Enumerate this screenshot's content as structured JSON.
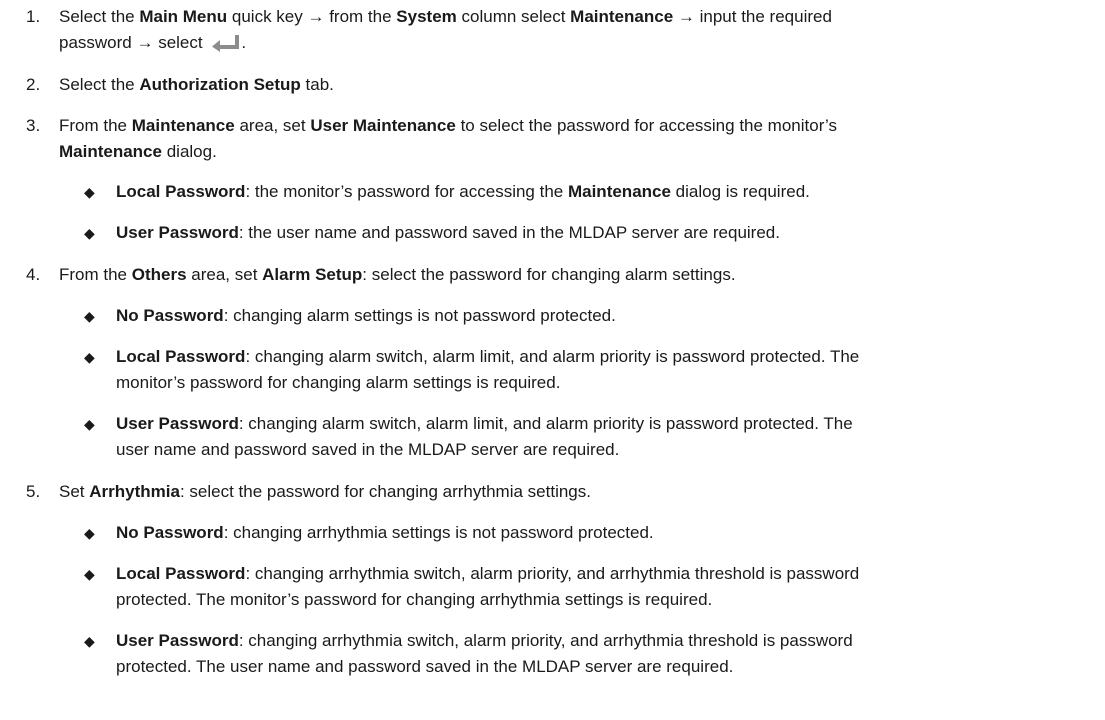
{
  "steps": [
    {
      "num": "1.",
      "seg": [
        "Select the ",
        "Main Menu",
        " quick key → from the ",
        "System",
        " column select ",
        "Maintenance",
        " → input the required",
        "password → select ",
        "."
      ]
    },
    {
      "num": "2.",
      "seg": [
        "Select the ",
        "Authorization Setup",
        " tab."
      ]
    },
    {
      "num": "3.",
      "seg": [
        "From the ",
        "Maintenance",
        " area, set ",
        "User Maintenance",
        " to select the password for accessing the monitor’s",
        "Maintenance",
        " dialog."
      ],
      "bullets": [
        {
          "term": "Local Password",
          "s1": ": the monitor’s password for accessing the ",
          "b2": "Maintenance",
          "s3": " dialog is required."
        },
        {
          "term": "User Password",
          "s1": ": the user name and password saved in the MLDAP server are required."
        }
      ]
    },
    {
      "num": "4.",
      "seg": [
        "From the ",
        "Others",
        " area, set ",
        "Alarm Setup",
        ": select the password for changing alarm settings."
      ],
      "bullets": [
        {
          "term": "No Password",
          "s1": ": changing alarm settings is not password protected."
        },
        {
          "term": "Local Password",
          "s1": ": changing alarm switch, alarm limit, and alarm priority is password protected. The",
          "s2": "monitor’s password for changing alarm settings is required."
        },
        {
          "term": "User Password",
          "s1": ": changing alarm switch, alarm limit, and alarm priority is password protected. The",
          "s2": "user name and password saved in the MLDAP server are required."
        }
      ]
    },
    {
      "num": "5.",
      "seg": [
        "Set ",
        "Arrhythmia",
        ": select the password for changing arrhythmia settings."
      ],
      "bullets": [
        {
          "term": "No Password",
          "s1": ": changing arrhythmia settings is not password protected."
        },
        {
          "term": "Local Password",
          "s1": ": changing arrhythmia switch, alarm priority, and arrhythmia threshold is password",
          "s2": "protected. The monitor’s password for changing arrhythmia settings is required."
        },
        {
          "term": "User Password",
          "s1": ": changing arrhythmia switch, alarm priority, and arrhythmia threshold is password",
          "s2": "protected. The user name and password saved in the MLDAP server are required."
        }
      ]
    }
  ],
  "icon": "enter-key-icon",
  "icon_color": "#8c8c8c",
  "bullet_glyph": "◆"
}
